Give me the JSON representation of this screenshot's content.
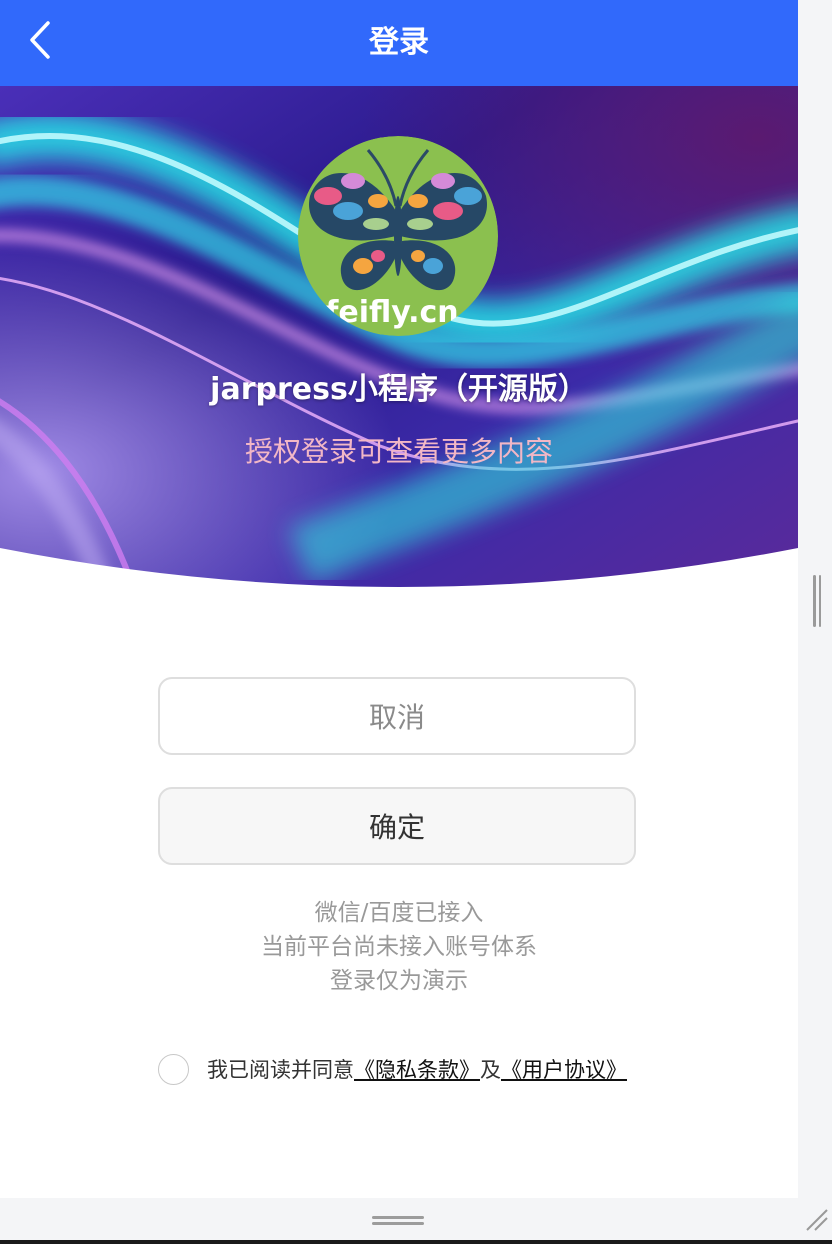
{
  "navbar": {
    "title": "登录",
    "back_icon": "chevron-left-icon"
  },
  "hero": {
    "logo_text": "feifly.cn",
    "app_name": "jarpress小程序（开源版）",
    "subtitle": "授权登录可查看更多内容"
  },
  "buttons": {
    "cancel_label": "取消",
    "confirm_label": "确定"
  },
  "note": {
    "line1": "微信/百度已接入",
    "line2": "当前平台尚未接入账号体系",
    "line3": "登录仅为演示"
  },
  "agreement": {
    "prefix": "我已阅读并同意",
    "privacy_link": "《隐私条款》",
    "and": "及",
    "terms_link": "《用户协议》",
    "checked": false
  },
  "colors": {
    "navbar": "#3169fb",
    "logo_bg": "#8bc04f",
    "subtitle": "#f2b7c6",
    "note_text": "#999999"
  }
}
